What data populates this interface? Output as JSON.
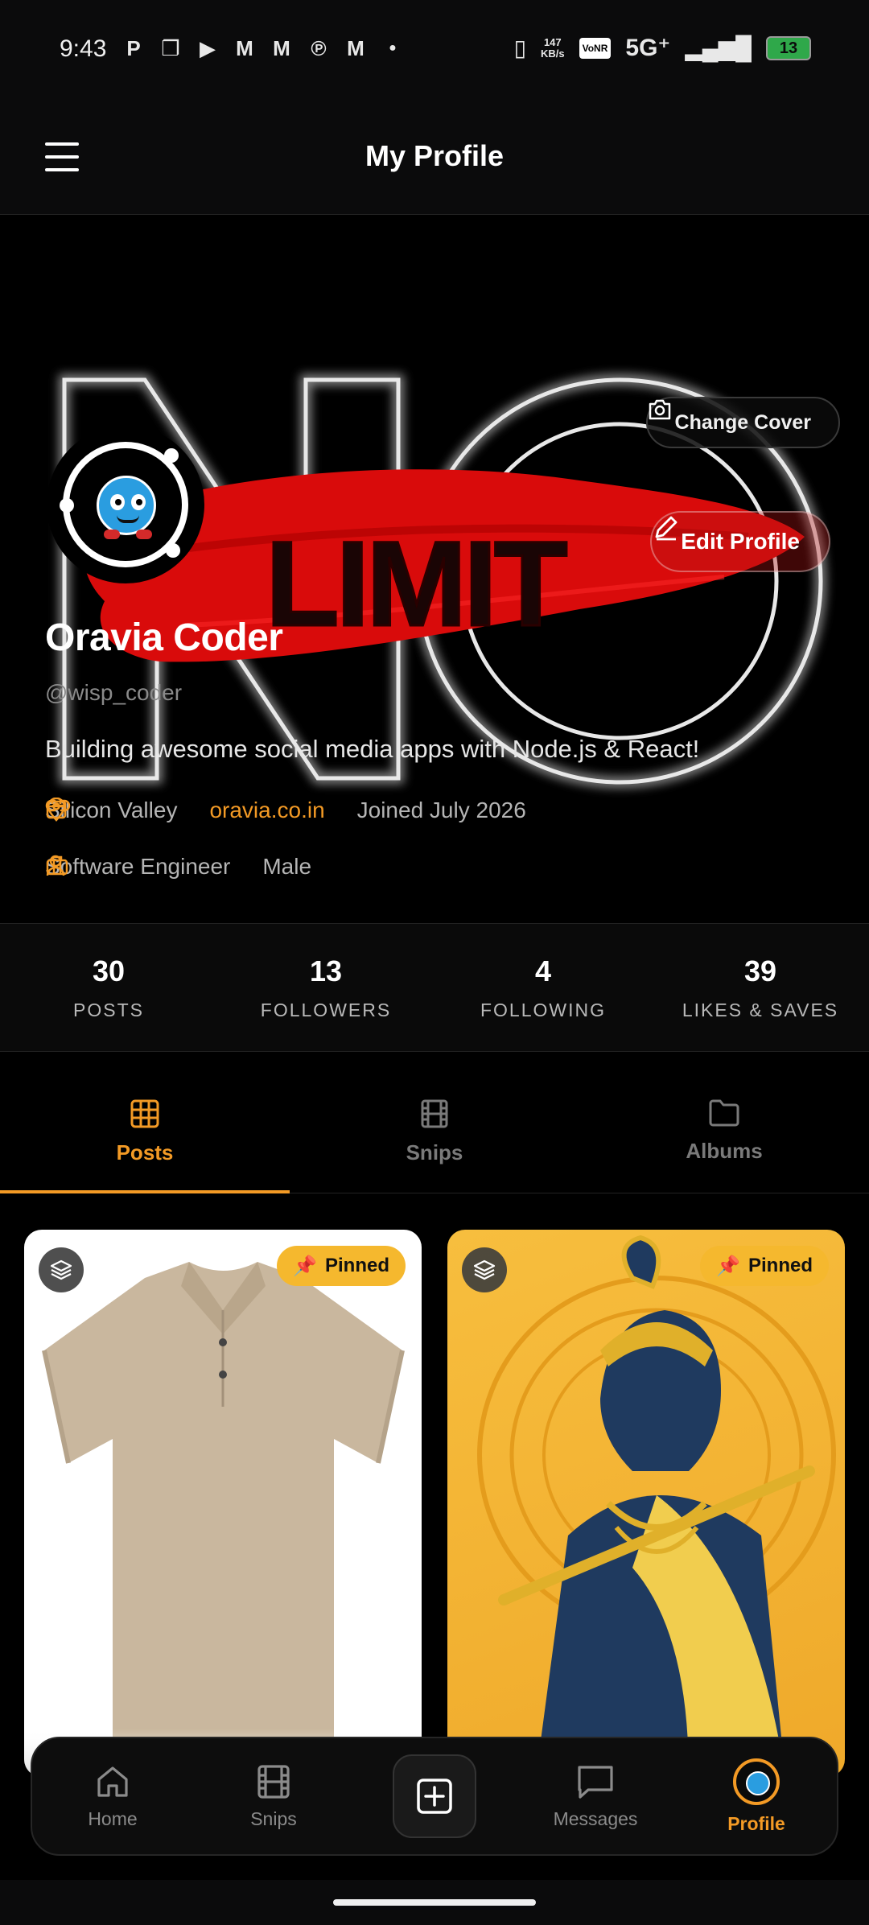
{
  "status_bar": {
    "time": "9:43",
    "net_speed_value": "147",
    "net_speed_unit": "KB/s",
    "vonr": "VoNR",
    "network": "5G⁺",
    "battery": "13"
  },
  "header": {
    "title": "My Profile"
  },
  "cover": {
    "change_cover_label": "Change Cover",
    "edit_profile_label": "Edit Profile",
    "art_text": "LIMIT"
  },
  "profile": {
    "name": "Oravia Coder",
    "handle": "@wisp_coder",
    "bio": "Building awesome social media apps with Node.js & React!",
    "location": "Silicon Valley",
    "website": "oravia.co.in",
    "joined": "Joined July 2026",
    "occupation": "Software Engineer",
    "gender": "Male"
  },
  "stats": [
    {
      "value": "30",
      "label": "POSTS"
    },
    {
      "value": "13",
      "label": "FOLLOWERS"
    },
    {
      "value": "4",
      "label": "FOLLOWING"
    },
    {
      "value": "39",
      "label": "LIKES & SAVES"
    }
  ],
  "tabs": [
    {
      "label": "Posts",
      "icon": "grid-icon",
      "active": true
    },
    {
      "label": "Snips",
      "icon": "film-icon",
      "active": false
    },
    {
      "label": "Albums",
      "icon": "folder-icon",
      "active": false
    }
  ],
  "posts": [
    {
      "badge": "Pinned",
      "image": "beige polo shirt"
    },
    {
      "badge": "Pinned",
      "image": "krishna with flute illustration"
    }
  ],
  "bottom_nav": [
    {
      "label": "Home",
      "icon": "home-icon"
    },
    {
      "label": "Snips",
      "icon": "film-icon"
    },
    {
      "label": "",
      "icon": "add-icon"
    },
    {
      "label": "Messages",
      "icon": "message-icon"
    },
    {
      "label": "Profile",
      "icon": "avatar-icon",
      "active": true
    }
  ],
  "colors": {
    "accent": "#f39a25",
    "pinned_badge": "#f5b82e",
    "background": "#000000"
  }
}
